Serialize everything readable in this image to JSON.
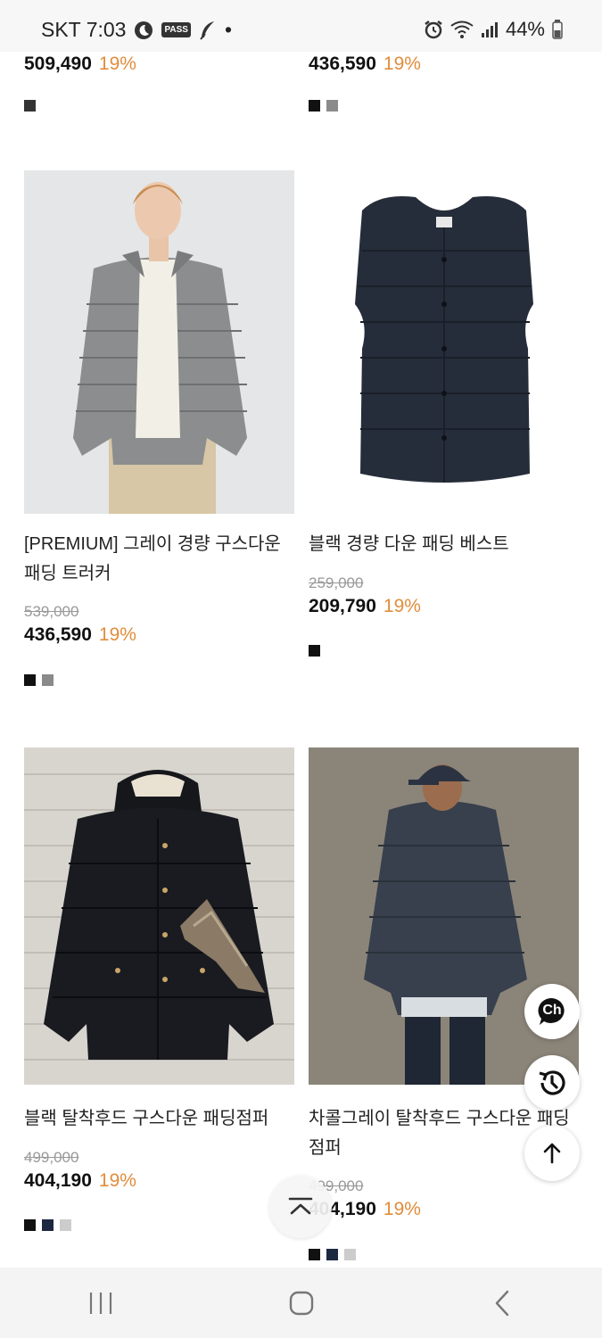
{
  "status_bar": {
    "carrier_time": "SKT 7:03",
    "pass_label": "PASS",
    "dot": "•",
    "battery": "44%"
  },
  "top_row": [
    {
      "price": "509,490",
      "discount": "19%",
      "colors": [
        "#333333"
      ]
    },
    {
      "price": "436,590",
      "discount": "19%",
      "colors": [
        "#111111",
        "#8a8a8a"
      ]
    }
  ],
  "products": [
    {
      "name": "[PREMIUM] 그레이 경량 구스다운 패딩 트러커",
      "original_price": "539,000",
      "price": "436,590",
      "discount": "19%",
      "colors": [
        "#111111",
        "#8a8a8a"
      ]
    },
    {
      "name": "블랙 경량 다운 패딩 베스트",
      "original_price": "259,000",
      "price": "209,790",
      "discount": "19%",
      "colors": [
        "#111111"
      ]
    },
    {
      "name": "블랙 탈착후드 구스다운 패딩점퍼",
      "original_price": "499,000",
      "price": "404,190",
      "discount": "19%",
      "colors": [
        "#111111",
        "#1c2840",
        "#cccccc"
      ]
    },
    {
      "name": "차콜그레이 탈착후드 구스다운 패딩점퍼",
      "original_price": "499,000",
      "price": "404,190",
      "discount": "19%",
      "colors": [
        "#111111",
        "#1c2840",
        "#cccccc"
      ]
    }
  ],
  "fab": {
    "chat_label": "Ch"
  },
  "colors": {
    "discount": "#e08d3c",
    "price": "#111111"
  }
}
